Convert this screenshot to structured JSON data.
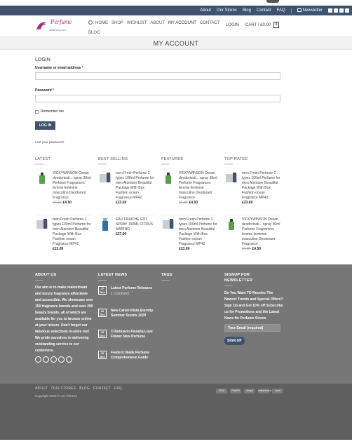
{
  "topbar": {
    "links": [
      "About",
      "Our Stores",
      "Blog",
      "Contact",
      "FAQ"
    ],
    "newsletter": "Newsletter"
  },
  "header": {
    "logo_brand": "Perfume",
    "logo_sub": "for",
    "logo_tld": "allfairsup.com",
    "nav": [
      "HOME",
      "SHOP",
      "WISHLIST",
      "ABOUT",
      "MY ACCOUNT",
      "CONTACT",
      "BLOG"
    ],
    "login": "LOGIN",
    "cart": "CART / £0.00",
    "cart_count": "0"
  },
  "page": {
    "title": "MY ACCOUNT"
  },
  "login": {
    "heading": "LOGIN",
    "username_label": "Username or email address",
    "password_label": "Password",
    "required_mark": "*",
    "remember": "Remember me",
    "button": "LOG IN",
    "lost": "Lost your password?"
  },
  "products": {
    "latest": {
      "title": "LATEST",
      "items": [
        {
          "name": "VICKYWINSON Ocean deodorizati... spray 30ml Perfume Fragrances femme feminine masculino Deodorant Fragrance",
          "old": "£7.00",
          "price": "£4.50"
        },
        {
          "name": "men Fresh Perfume 2 types 100ml Perfume for men Atomizer Beautiful Package With Box Fashion ocean Fragrance MP42",
          "old": "",
          "price": "£23.69"
        }
      ]
    },
    "best": {
      "title": "BEST SELLING",
      "items": [
        {
          "name": "men Fresh Perfume 2 types 100ml Perfume for men Atomizer Beautiful Package With Box Fashion ocean Fragrance MP42",
          "old": "",
          "price": "£23.69"
        },
        {
          "name": "EAU FRAICHE EDT SPRAY 150ML CITRUS MARINO",
          "old": "",
          "price": "£27.00"
        }
      ]
    },
    "featured": {
      "title": "FEATURED",
      "items": [
        {
          "name": "VICKYWINSON Ocean deodorizati... spray 30ml Perfume Fragrances femme feminine masculino Deodorant Fragrance",
          "old": "£7.00",
          "price": "£4.50"
        },
        {
          "name": "men Fresh Perfume 2 types 100ml Perfume for men Atomizer Beautiful Package With Box Fashion ocean Fragrance MP42",
          "old": "",
          "price": "£23.69"
        }
      ]
    },
    "top": {
      "title": "TOP RATED",
      "items": [
        {
          "name": "men Fresh Perfume 2 types 100ml Perfume for men Atomizer Beautiful Package With Box Fashion ocean Fragrance MP42",
          "old": "",
          "price": "£23.69"
        },
        {
          "name": "VICKYWINSON Ocean deodorizati... spray 30ml Perfume Fragrances femme feminine masculino Deodorant Fragrance",
          "old": "£7.00",
          "price": "£4.50"
        }
      ]
    }
  },
  "footer": {
    "about_title": "ABOUT US",
    "about_text": "Our aim is to make mainstream and luxury fragrance affordable and accessible. We showcase over 150 fragrance brands and over 200 beauty brands, all of which are available for you to browse online at your leisure. Don't forget our fabulous selections in-store too! We pride ourselves in delivering outstanding service to our customers.",
    "news_title": "LATEST NEWS",
    "news": [
      {
        "day": "27",
        "mon": "Dec",
        "title": "Latest Perfume Releases",
        "comment": "1 Comment"
      },
      {
        "day": "23",
        "mon": "Dec",
        "title": "New Calvin Klein Eternity Summer Scents 2020",
        "comment": ""
      },
      {
        "day": "23",
        "mon": "Dec",
        "title": "O Boticario Floratta Love Flower New Perfume",
        "comment": ""
      },
      {
        "day": "23",
        "mon": "Dec",
        "title": "Frederic Malle Perfume Comprehensive Guide",
        "comment": ""
      }
    ],
    "tags_title": "TAGS",
    "signup_title": "SIGNUP FOR NEWSLETTER",
    "signup_text": "Do You Want TO Receive The Newest Trends and Special Offers? Sign Up and Get 10% off Subscribe us for Promotions and the Latest News for Perfume Stores",
    "email_placeholder": "Your Email (required)",
    "signup_button": "SIGN UP",
    "bottom_links": [
      "ABOUT",
      "OUR STORES",
      "BLOG",
      "CONTACT",
      "FAQ"
    ],
    "copyright": "Copyright 2020 © UX Themes",
    "payments": [
      "VISA",
      "PayPal",
      "stripe",
      "mastercard",
      "cash"
    ]
  }
}
